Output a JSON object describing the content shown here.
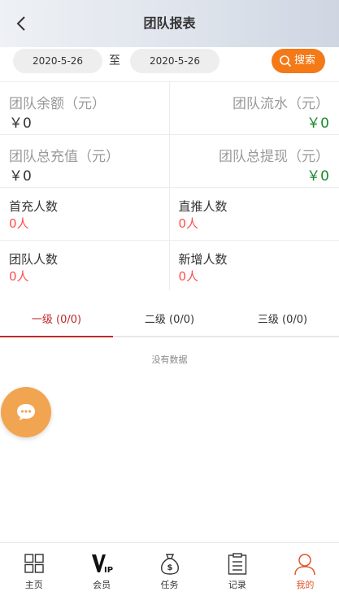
{
  "header": {
    "title": "团队报表"
  },
  "filter": {
    "start_date": "2020-5-26",
    "separator": "至",
    "end_date": "2020-5-26",
    "search_label": "搜索"
  },
  "stats": {
    "balance": {
      "label": "团队余额（元）",
      "value": "￥0"
    },
    "turnover": {
      "label": "团队流水（元）",
      "value": "￥0"
    },
    "total_recharge": {
      "label": "团队总充值（元）",
      "value": "￥0"
    },
    "total_withdraw": {
      "label": "团队总提现（元）",
      "value": "￥0"
    },
    "first_recharge": {
      "label": "首充人数",
      "value": "0人"
    },
    "direct_referrals": {
      "label": "直推人数",
      "value": "0人"
    },
    "team_members": {
      "label": "团队人数",
      "value": "0人"
    },
    "new_members": {
      "label": "新增人数",
      "value": "0人"
    }
  },
  "tabs": [
    {
      "label": "一级 (0/0)",
      "active": true
    },
    {
      "label": "二级 (0/0)",
      "active": false
    },
    {
      "label": "三级 (0/0)",
      "active": false
    }
  ],
  "empty_text": "没有数据",
  "tabbar": [
    {
      "label": "主页",
      "icon": "grid-icon"
    },
    {
      "label": "会员",
      "icon": "vip-icon"
    },
    {
      "label": "任务",
      "icon": "money-bag-icon"
    },
    {
      "label": "记录",
      "icon": "clipboard-icon"
    },
    {
      "label": "我的",
      "icon": "user-icon",
      "active": true
    }
  ],
  "colors": {
    "accent": "#f47a18",
    "active_tab": "#c0282a",
    "positive": "#1a8a2a",
    "count": "#ff4d4d",
    "fab": "#f2a550"
  }
}
